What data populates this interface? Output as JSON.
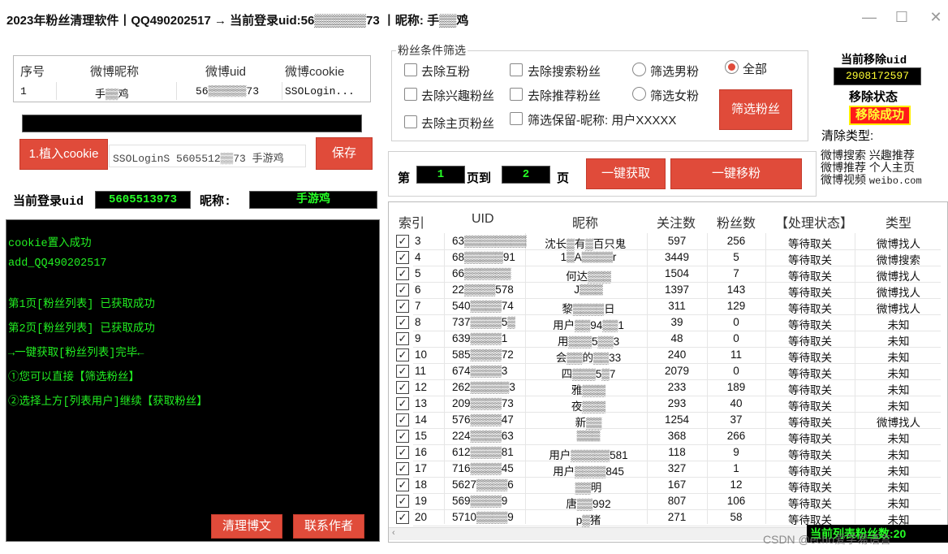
{
  "window": {
    "title": "2023年粉丝清理软件丨QQ490202517  →  当前登录uid:56▒▒▒▒▒▒73  丨昵称:  手▒▒鸡"
  },
  "account_table": {
    "headers": [
      "序号",
      "微博昵称",
      "微博uid",
      "微博cookie"
    ],
    "row": {
      "index": "1",
      "nickname": "手▒▒鸡",
      "uid": "56▒▒▒▒▒▒73",
      "cookie": "SSOLogin..."
    }
  },
  "cookie": {
    "button": "1.植入cookie",
    "value": "SSOLoginS 5605512▒▒73 手游鸡",
    "save": "保存"
  },
  "login": {
    "uid_label": "当前登录uid",
    "uid_value": "5605513973",
    "nick_label": "昵称:",
    "nick_value": "手游鸡"
  },
  "log": [
    "cookie置入成功",
    "add_QQ490202517",
    "第1页[粉丝列表] 已获取成功",
    "第2页[粉丝列表] 已获取成功",
    "→一键获取[粉丝列表]完毕←",
    "①您可以直接【筛选粉丝】",
    "②选择上方[列表用户]继续【获取粉丝】"
  ],
  "left_buttons": {
    "clean": "清理博文",
    "contact": "联系作者"
  },
  "filter": {
    "legend": "粉丝条件筛选",
    "options": {
      "mutual": "去除互粉",
      "search": "去除搜索粉丝",
      "interest": "去除兴趣粉丝",
      "recommend": "去除推荐粉丝",
      "homepage": "去除主页粉丝",
      "keep": "筛选保留-昵称: 用户XXXXX"
    },
    "gender": {
      "male": "筛选男粉",
      "female": "筛选女粉",
      "all": "全部",
      "selected": "全部"
    },
    "button": "筛选粉丝"
  },
  "status_panel": {
    "current_label": "当前移除uid",
    "current_uid": "2908172597",
    "state_label": "移除状态",
    "state_value": "移除成功",
    "type_label": "清除类型:",
    "types": [
      "微博搜索",
      "兴趣推荐",
      "微博推荐",
      "个人主页",
      "微博视频",
      "weibo.com"
    ]
  },
  "pager": {
    "prefix": "第",
    "from": "1",
    "mid": "页到",
    "to": "2",
    "suffix": "页",
    "fetch": "一键获取",
    "remove": "一键移粉"
  },
  "table": {
    "headers": [
      "索引",
      "UID",
      "昵称",
      "关注数",
      "粉丝数",
      "【处理状态】",
      "类型"
    ],
    "rows": [
      {
        "idx": "3",
        "uid": "63▒▒▒▒▒▒▒▒",
        "nick": "沈长▒有▒百只鬼_",
        "follow": "597",
        "fans": "256",
        "state": "等待取关",
        "type": "微博找人"
      },
      {
        "idx": "4",
        "uid": "68▒▒▒▒▒91",
        "nick": "1▒A▒▒▒▒r",
        "follow": "3449",
        "fans": "5",
        "state": "等待取关",
        "type": "微博搜索"
      },
      {
        "idx": "5",
        "uid": "66▒▒▒▒▒▒",
        "nick": "何达▒▒▒",
        "follow": "1504",
        "fans": "7",
        "state": "等待取关",
        "type": "微博找人"
      },
      {
        "idx": "6",
        "uid": "22▒▒▒▒578",
        "nick": "J▒▒▒",
        "follow": "1397",
        "fans": "143",
        "state": "等待取关",
        "type": "微博找人"
      },
      {
        "idx": "7",
        "uid": "540▒▒▒▒74",
        "nick": "黎▒▒▒▒日",
        "follow": "311",
        "fans": "129",
        "state": "等待取关",
        "type": "微博找人"
      },
      {
        "idx": "8",
        "uid": "737▒▒▒▒5▒",
        "nick": "用户▒▒94▒▒1",
        "follow": "39",
        "fans": "0",
        "state": "等待取关",
        "type": "未知"
      },
      {
        "idx": "9",
        "uid": "639▒▒▒▒1",
        "nick": "用▒▒▒5▒▒3",
        "follow": "48",
        "fans": "0",
        "state": "等待取关",
        "type": "未知"
      },
      {
        "idx": "10",
        "uid": "585▒▒▒▒72",
        "nick": "会▒▒的▒▒33",
        "follow": "240",
        "fans": "11",
        "state": "等待取关",
        "type": "未知"
      },
      {
        "idx": "11",
        "uid": "674▒▒▒▒3",
        "nick": "四▒▒▒5▒7",
        "follow": "2079",
        "fans": "0",
        "state": "等待取关",
        "type": "未知"
      },
      {
        "idx": "12",
        "uid": "262▒▒▒▒▒3",
        "nick": "雅▒▒▒",
        "follow": "233",
        "fans": "189",
        "state": "等待取关",
        "type": "未知"
      },
      {
        "idx": "13",
        "uid": "209▒▒▒▒73",
        "nick": "夜▒▒▒",
        "follow": "293",
        "fans": "40",
        "state": "等待取关",
        "type": "未知"
      },
      {
        "idx": "14",
        "uid": "576▒▒▒▒47",
        "nick": "新▒▒",
        "follow": "1254",
        "fans": "37",
        "state": "等待取关",
        "type": "微博找人"
      },
      {
        "idx": "15",
        "uid": "224▒▒▒▒63",
        "nick": "▒▒▒",
        "follow": "368",
        "fans": "266",
        "state": "等待取关",
        "type": "未知"
      },
      {
        "idx": "16",
        "uid": "612▒▒▒▒81",
        "nick": "用户▒▒▒▒▒581",
        "follow": "118",
        "fans": "9",
        "state": "等待取关",
        "type": "未知"
      },
      {
        "idx": "17",
        "uid": "716▒▒▒▒45",
        "nick": "用户▒▒▒▒845",
        "follow": "327",
        "fans": "1",
        "state": "等待取关",
        "type": "未知"
      },
      {
        "idx": "18",
        "uid": "5627▒▒▒▒6",
        "nick": "▒▒明",
        "follow": "167",
        "fans": "12",
        "state": "等待取关",
        "type": "未知"
      },
      {
        "idx": "19",
        "uid": "569▒▒▒▒9",
        "nick": "唐▒▒992",
        "follow": "807",
        "fans": "106",
        "state": "等待取关",
        "type": "未知"
      },
      {
        "idx": "20",
        "uid": "5710▒▒▒▒9",
        "nick": "p▒猪",
        "follow": "271",
        "fans": "58",
        "state": "等待取关",
        "type": "未知"
      }
    ]
  },
  "footer": {
    "list_count": "当前列表粉丝数:20",
    "watermark": "CSDN @echo爱学易语言"
  }
}
